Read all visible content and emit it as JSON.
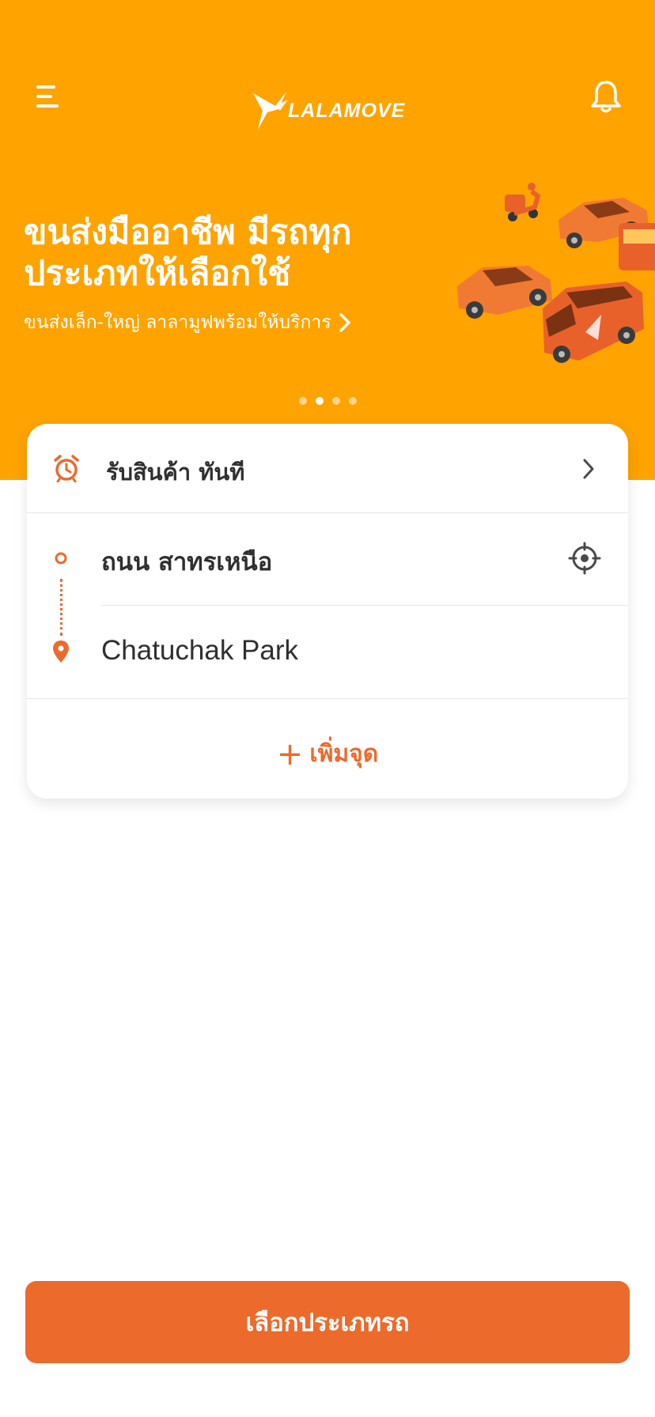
{
  "header": {
    "logo_text": "LALAMOVE",
    "hero_title": "ขนส่งมืออาชีพ มีรถทุกประเภทให้เลือกใช้",
    "hero_subtitle": "ขนส่งเล็ก-ใหญ่ ลาลามูฟพร้อมให้บริการ",
    "carousel_pages": 4,
    "carousel_active_index": 1
  },
  "order": {
    "schedule_label": "รับสินค้า ทันที",
    "pickup_address": "ถนน สาทรเหนือ",
    "dropoff_address": "Chatuchak Park",
    "add_stop_label": "เพิ่มจุด"
  },
  "footer": {
    "select_vehicle_label": "เลือกประเภทรถ"
  },
  "colors": {
    "hero_background": "#FFA300",
    "accent": "#EC6A2C"
  },
  "icons": [
    "menu-icon",
    "lalamove-logo-icon",
    "bell-icon",
    "alarm-clock-icon",
    "chevron-right-icon",
    "pickup-dot-icon",
    "location-pin-icon",
    "locate-me-icon",
    "plus-icon"
  ]
}
